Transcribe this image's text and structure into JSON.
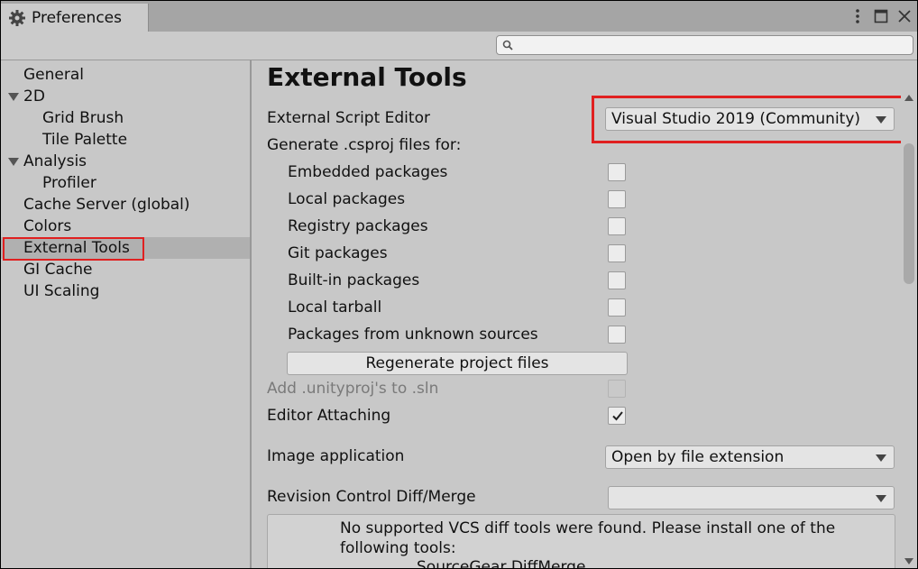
{
  "window": {
    "title": "Preferences"
  },
  "search": {
    "placeholder": "",
    "value": ""
  },
  "sidebar": {
    "items": [
      {
        "label": "General"
      },
      {
        "label": "2D"
      },
      {
        "label": "Grid Brush"
      },
      {
        "label": "Tile Palette"
      },
      {
        "label": "Analysis"
      },
      {
        "label": "Profiler"
      },
      {
        "label": "Cache Server (global)"
      },
      {
        "label": "Colors"
      },
      {
        "label": "External Tools",
        "selected": true
      },
      {
        "label": "GI Cache"
      },
      {
        "label": "UI Scaling"
      }
    ]
  },
  "main": {
    "heading": "External Tools",
    "script_editor": {
      "label": "External Script Editor",
      "value": "Visual Studio 2019 (Community)"
    },
    "generate_label": "Generate .csproj files for:",
    "packages": [
      {
        "label": "Embedded packages",
        "checked": false
      },
      {
        "label": "Local packages",
        "checked": false
      },
      {
        "label": "Registry packages",
        "checked": false
      },
      {
        "label": "Git packages",
        "checked": false
      },
      {
        "label": "Built-in packages",
        "checked": false
      },
      {
        "label": "Local tarball",
        "checked": false
      },
      {
        "label": "Packages from unknown sources",
        "checked": false
      }
    ],
    "regenerate_button": "Regenerate project files",
    "unityproj": {
      "label": "Add .unityproj's to .sln",
      "checked": false,
      "disabled": true
    },
    "editor_attaching": {
      "label": "Editor Attaching",
      "checked": true
    },
    "image_application": {
      "label": "Image application",
      "value": "Open by file extension"
    },
    "revision_control": {
      "label": "Revision Control Diff/Merge",
      "value": ""
    },
    "help": {
      "text": "No supported VCS diff tools were found. Please install one of the following tools:",
      "tool": "SourceGear DiffMerge"
    }
  },
  "colors": {
    "highlight": "#e02020",
    "selection": "#b0b0b0"
  }
}
